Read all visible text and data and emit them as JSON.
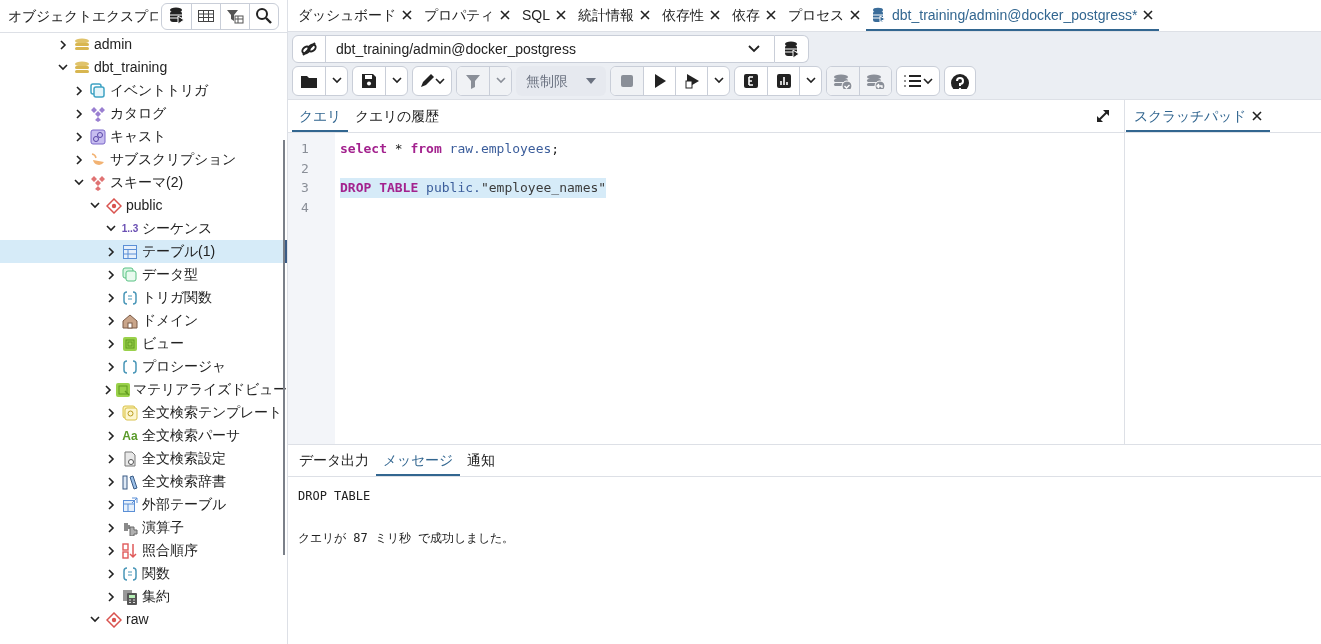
{
  "explorer": {
    "title": "オブジェクトエクスプロ",
    "tools": [
      {
        "kind": "database"
      },
      {
        "kind": "grid"
      },
      {
        "kind": "filter"
      },
      {
        "kind": "search"
      }
    ]
  },
  "tree": [
    {
      "label": "admin",
      "kind": "database",
      "expanded": false,
      "selected": false
    },
    {
      "label": "dbt_training",
      "kind": "database",
      "expanded": true,
      "selected": false,
      "children": [
        {
          "label": "イベントトリガ",
          "kind": "event-trigger",
          "expanded": false,
          "selected": false
        },
        {
          "label": "カタログ",
          "kind": "catalog",
          "expanded": false,
          "selected": false
        },
        {
          "label": "キャスト",
          "kind": "cast",
          "expanded": false,
          "selected": false
        },
        {
          "label": "サブスクリプション",
          "kind": "subscription",
          "expanded": false,
          "selected": false
        },
        {
          "label": "スキーマ(2)",
          "kind": "schemas",
          "expanded": true,
          "selected": false,
          "children": [
            {
              "label": "public",
              "kind": "schema",
              "expanded": true,
              "selected": false,
              "children": [
                {
                  "label": "シーケンス",
                  "kind": "sequence",
                  "badge": "1..3",
                  "expanded": true,
                  "selected": false
                },
                {
                  "label": "テーブル(1)",
                  "kind": "table",
                  "expanded": false,
                  "selected": true
                },
                {
                  "label": "データ型",
                  "kind": "type",
                  "expanded": false,
                  "selected": false
                },
                {
                  "label": "トリガ関数",
                  "kind": "trigger-function",
                  "expanded": false,
                  "selected": false
                },
                {
                  "label": "ドメイン",
                  "kind": "domain",
                  "expanded": false,
                  "selected": false
                },
                {
                  "label": "ビュー",
                  "kind": "view",
                  "expanded": false,
                  "selected": false
                },
                {
                  "label": "プロシージャ",
                  "kind": "procedure",
                  "expanded": false,
                  "selected": false
                },
                {
                  "label": "マテリアライズドビュー",
                  "kind": "mview",
                  "expanded": false,
                  "selected": false
                },
                {
                  "label": "全文検索テンプレート",
                  "kind": "fts-template",
                  "expanded": false,
                  "selected": false
                },
                {
                  "label": "全文検索パーサ",
                  "kind": "fts-parser",
                  "badge": "Aa",
                  "expanded": false,
                  "selected": false
                },
                {
                  "label": "全文検索設定",
                  "kind": "fts-config",
                  "expanded": false,
                  "selected": false
                },
                {
                  "label": "全文検索辞書",
                  "kind": "fts-dictionary",
                  "expanded": false,
                  "selected": false
                },
                {
                  "label": "外部テーブル",
                  "kind": "foreign-table",
                  "expanded": false,
                  "selected": false
                },
                {
                  "label": "演算子",
                  "kind": "operator",
                  "expanded": false,
                  "selected": false
                },
                {
                  "label": "照合順序",
                  "kind": "collation",
                  "expanded": false,
                  "selected": false
                },
                {
                  "label": "関数",
                  "kind": "function",
                  "expanded": false,
                  "selected": false
                },
                {
                  "label": "集約",
                  "kind": "aggregate",
                  "expanded": false,
                  "selected": false
                }
              ]
            },
            {
              "label": "raw",
              "kind": "schema",
              "expanded": true,
              "selected": false
            }
          ]
        }
      ]
    }
  ],
  "tabs": [
    {
      "label": "ダッシュボード",
      "selected": false
    },
    {
      "label": "プロパティ",
      "selected": false
    },
    {
      "label": "SQL",
      "selected": false
    },
    {
      "label": "統計情報",
      "selected": false
    },
    {
      "label": "依存性",
      "selected": false
    },
    {
      "label": "依存",
      "selected": false
    },
    {
      "label": "プロセス",
      "selected": false
    },
    {
      "label": "dbt_training/admin@docker_postgress*",
      "kind": "query",
      "selected": true
    }
  ],
  "connection": {
    "value": "dbt_training/admin@docker_postgress"
  },
  "toolbar": [
    {
      "buttons": [
        {
          "kind": "folder",
          "disabled": false
        },
        {
          "kind": "caret",
          "disabled": false
        }
      ]
    },
    {
      "buttons": [
        {
          "kind": "save",
          "disabled": false
        },
        {
          "kind": "caret",
          "disabled": false
        }
      ]
    },
    {
      "buttons": [
        {
          "kind": "pen",
          "disabled": false
        }
      ]
    },
    {
      "buttons": [
        {
          "kind": "filter",
          "disabled": true
        },
        {
          "kind": "caret",
          "disabled": true
        }
      ]
    },
    {
      "buttons": [
        {
          "kind": "select",
          "label": "無制限"
        }
      ]
    },
    {
      "buttons": [
        {
          "kind": "stop",
          "disabled": true
        },
        {
          "kind": "play",
          "disabled": false
        },
        {
          "kind": "play-script",
          "disabled": false
        },
        {
          "kind": "caret",
          "disabled": false
        }
      ]
    },
    {
      "buttons": [
        {
          "kind": "explain",
          "disabled": false
        },
        {
          "kind": "chart",
          "disabled": false
        },
        {
          "kind": "caret",
          "disabled": false
        }
      ]
    },
    {
      "buttons": [
        {
          "kind": "commit",
          "disabled": true
        },
        {
          "kind": "rollback",
          "disabled": true
        }
      ]
    },
    {
      "buttons": [
        {
          "kind": "list",
          "disabled": false
        }
      ]
    },
    {
      "buttons": [
        {
          "kind": "help",
          "disabled": false
        }
      ]
    }
  ],
  "query_tabs": [
    {
      "label": "クエリ",
      "selected": true
    },
    {
      "label": "クエリの履歴",
      "selected": false
    }
  ],
  "editor": {
    "lines": [
      {
        "number": "1",
        "selected": false,
        "tokens": [
          {
            "text": "select",
            "kind": "keyword"
          },
          {
            "text": " * ",
            "kind": "plain"
          },
          {
            "text": "from",
            "kind": "keyword"
          },
          {
            "text": " raw.employees",
            "kind": "name"
          },
          {
            "text": ";",
            "kind": "plain"
          }
        ]
      },
      {
        "number": "2"
      },
      {
        "number": "3",
        "selected": true,
        "tokens": [
          {
            "text": "DROP TABLE",
            "kind": "keyword"
          },
          {
            "text": " public.",
            "kind": "name"
          },
          {
            "text": "\"employee_names\"",
            "kind": "string"
          }
        ]
      },
      {
        "number": "4"
      }
    ]
  },
  "scratch_pad": {
    "title": "スクラッチパッド"
  },
  "output_tabs": [
    {
      "label": "データ出力",
      "selected": false
    },
    {
      "label": "メッセージ",
      "selected": true
    },
    {
      "label": "通知",
      "selected": false
    }
  ],
  "messages": [
    "DROP TABLE",
    "クエリが 87 ミリ秒 で成功しました。"
  ]
}
